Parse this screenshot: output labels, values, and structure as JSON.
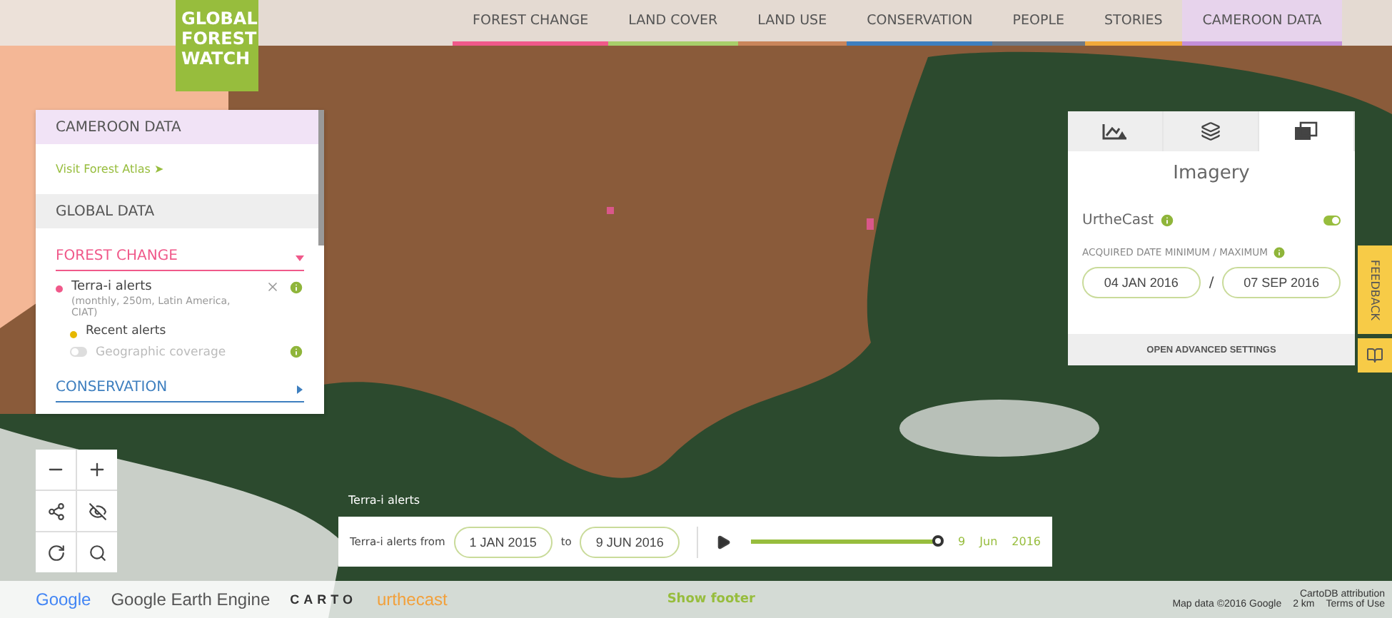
{
  "logo": [
    "GLOBAL",
    "FOREST",
    "WATCH"
  ],
  "nav": [
    {
      "label": "FOREST CHANGE",
      "color": "#f0598a",
      "selected": false
    },
    {
      "label": "LAND COVER",
      "color": "#a8cf6a",
      "selected": false
    },
    {
      "label": "LAND USE",
      "color": "#c9855b",
      "selected": false
    },
    {
      "label": "CONSERVATION",
      "color": "#3e7fbf",
      "selected": false
    },
    {
      "label": "PEOPLE",
      "color": "#707a86",
      "selected": false
    },
    {
      "label": "STORIES",
      "color": "#f2a93b",
      "selected": false
    },
    {
      "label": "CAMEROON DATA",
      "color": "#c38fd8",
      "selected": true
    }
  ],
  "layers_panel": {
    "country_title": "CAMEROON DATA",
    "atlas_link": "Visit Forest Atlas ➤",
    "global_title": "GLOBAL DATA",
    "categories": [
      {
        "title": "FOREST CHANGE",
        "color": "#f0598a",
        "expanded": true,
        "layers": [
          {
            "name": "Terra-i alerts",
            "meta": "(monthly, 250m, Latin America, CIAT)",
            "color": "#f0598a",
            "sublayers": [
              {
                "kind": "dot",
                "name": "Recent alerts",
                "color": "#e6b800"
              },
              {
                "kind": "toggle",
                "name": "Geographic coverage",
                "on": false
              }
            ]
          }
        ]
      },
      {
        "title": "CONSERVATION",
        "color": "#3e7fbf",
        "expanded": false
      }
    ]
  },
  "imagery_panel": {
    "tabs": [
      {
        "kind": "analysis",
        "selected": false
      },
      {
        "kind": "layers",
        "selected": false
      },
      {
        "kind": "imagery",
        "selected": true
      }
    ],
    "title": "Imagery",
    "source": {
      "label": "UrtheCast",
      "on": true
    },
    "date_label": "ACQUIRED DATE MINIMUM / MAXIMUM",
    "date_min": "04 JAN 2016",
    "separator": "/",
    "date_max": "07 SEP 2016",
    "advanced": "OPEN ADVANCED SETTINGS"
  },
  "side_tabs": {
    "feedback": "FEEDBACK"
  },
  "map_label": "Terra-i alerts",
  "timeline": {
    "label": "Terra-i alerts from",
    "from": "1 JAN 2015",
    "to_word": "to",
    "to": "9 JUN 2016",
    "level": 0.97,
    "current": [
      "9",
      "Jun",
      "2016"
    ]
  },
  "footer": {
    "logos": [
      "Google",
      "Google Earth Engine",
      "CARTO",
      "urthecast"
    ],
    "show_footer": "Show footer",
    "attribution": "CartoDB attribution",
    "map_data": "Map data ©2016 Google",
    "scale": "2 km",
    "terms": "Terms of Use"
  }
}
